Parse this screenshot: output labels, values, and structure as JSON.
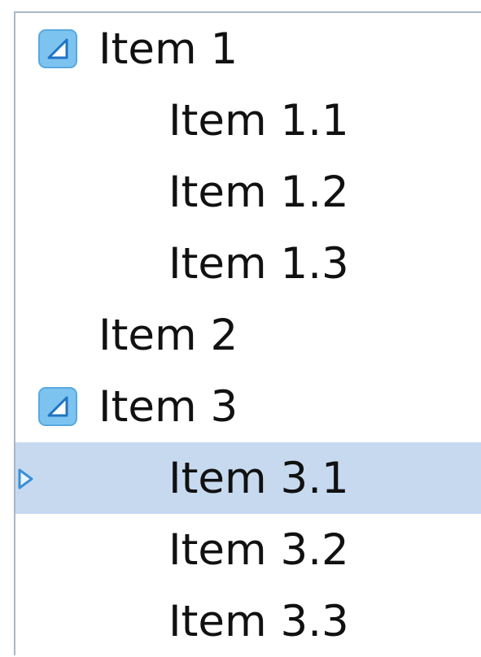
{
  "tree": {
    "items": [
      {
        "label": "Item 1",
        "level": 0,
        "expanded": true,
        "selected": false
      },
      {
        "label": "Item 1.1",
        "level": 1,
        "selected": false
      },
      {
        "label": "Item 1.2",
        "level": 1,
        "selected": false
      },
      {
        "label": "Item 1.3",
        "level": 1,
        "selected": false
      },
      {
        "label": "Item 2",
        "level": 0,
        "expanded": false,
        "selected": false
      },
      {
        "label": "Item 3",
        "level": 0,
        "expanded": true,
        "selected": false
      },
      {
        "label": "Item 3.1",
        "level": 1,
        "selected": true
      },
      {
        "label": "Item 3.2",
        "level": 1,
        "selected": false
      },
      {
        "label": "Item 3.3",
        "level": 1,
        "selected": false
      }
    ]
  },
  "colors": {
    "selection": "#c6d9ef",
    "border": "#a9b8c8",
    "expander_fill": "#7cc3f0",
    "expander_stroke": "#3a8fd6",
    "indicator": "#3a8fd6"
  },
  "icons": {
    "expander": "expanded-triangle-icon",
    "row_indicator": "current-row-arrow-icon"
  }
}
